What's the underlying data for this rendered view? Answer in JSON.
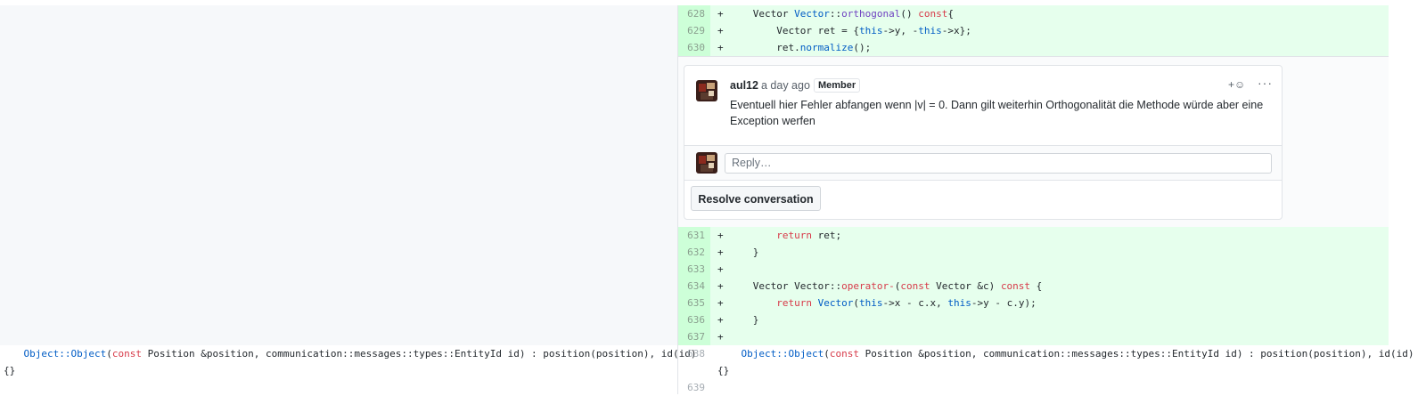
{
  "diff_added_top": [
    {
      "num": "628",
      "marker": "+",
      "tokens": [
        [
          "pl",
          "    Vector "
        ],
        [
          "bl",
          "Vector"
        ],
        [
          "pl",
          "::"
        ],
        [
          "fn",
          "orthogonal"
        ],
        [
          "pl",
          "() "
        ],
        [
          "kw",
          "const"
        ],
        [
          "pl",
          "{"
        ]
      ]
    },
    {
      "num": "629",
      "marker": "+",
      "tokens": [
        [
          "pl",
          "        Vector ret = {"
        ],
        [
          "bl",
          "this"
        ],
        [
          "pl",
          "->y, -"
        ],
        [
          "bl",
          "this"
        ],
        [
          "pl",
          "->x};"
        ]
      ]
    },
    {
      "num": "630",
      "marker": "+",
      "tokens": [
        [
          "pl",
          "        ret."
        ],
        [
          "bl",
          "normalize"
        ],
        [
          "pl",
          "();"
        ]
      ]
    }
  ],
  "comment": {
    "author": "aul12",
    "time_ago": "a day ago",
    "badge": "Member",
    "reaction_icon_label": "+☺",
    "more_icon_label": "···",
    "body": "Eventuell hier Fehler abfangen wenn |v| = 0. Dann gilt weiterhin Orthogonalität die Methode würde aber eine Exception werfen",
    "reply_placeholder": "Reply…",
    "resolve_label": "Resolve conversation"
  },
  "diff_added_bottom": [
    {
      "num": "631",
      "marker": "+",
      "tokens": [
        [
          "pl",
          "        "
        ],
        [
          "kw",
          "return"
        ],
        [
          "pl",
          " ret;"
        ]
      ]
    },
    {
      "num": "632",
      "marker": "+",
      "tokens": [
        [
          "pl",
          "    }"
        ]
      ]
    },
    {
      "num": "633",
      "marker": "+",
      "tokens": [
        [
          "pl",
          ""
        ]
      ]
    },
    {
      "num": "634",
      "marker": "+",
      "tokens": [
        [
          "pl",
          "    Vector Vector::"
        ],
        [
          "kw",
          "operator-"
        ],
        [
          "pl",
          "("
        ],
        [
          "kw",
          "const"
        ],
        [
          "pl",
          " Vector &c) "
        ],
        [
          "kw",
          "const"
        ],
        [
          "pl",
          " {"
        ]
      ]
    },
    {
      "num": "635",
      "marker": "+",
      "tokens": [
        [
          "pl",
          "        "
        ],
        [
          "kw",
          "return"
        ],
        [
          "pl",
          " "
        ],
        [
          "bl",
          "Vector"
        ],
        [
          "pl",
          "("
        ],
        [
          "bl",
          "this"
        ],
        [
          "pl",
          "->x - c.x, "
        ],
        [
          "bl",
          "this"
        ],
        [
          "pl",
          "->y - c.y);"
        ]
      ]
    },
    {
      "num": "636",
      "marker": "+",
      "tokens": [
        [
          "pl",
          "    }"
        ]
      ]
    },
    {
      "num": "637",
      "marker": "+",
      "tokens": [
        [
          "pl",
          ""
        ]
      ]
    }
  ],
  "context_left": [
    [
      [
        "bl",
        "    Object::Object"
      ],
      [
        "pl",
        "("
      ],
      [
        "kw",
        "const"
      ],
      [
        "pl",
        " Position &position, communication::messages::types::EntityId id) : position(position), id(id)"
      ]
    ],
    [
      [
        "pl",
        "{}"
      ]
    ]
  ],
  "context_right_nums": [
    "638",
    "639"
  ],
  "context_right": [
    [
      [
        "bl",
        "    Object::Object"
      ],
      [
        "pl",
        "("
      ],
      [
        "kw",
        "const"
      ],
      [
        "pl",
        " Position &position, communication::messages::types::EntityId id) : position(position), id(id)"
      ]
    ],
    [
      [
        "pl",
        "{}"
      ]
    ]
  ],
  "colors": {
    "addition_bg": "#e6ffed",
    "addition_num_bg": "#cdffd8",
    "keyword": "#d73a49",
    "function": "#6f42c1",
    "builtin": "#005cc5"
  }
}
